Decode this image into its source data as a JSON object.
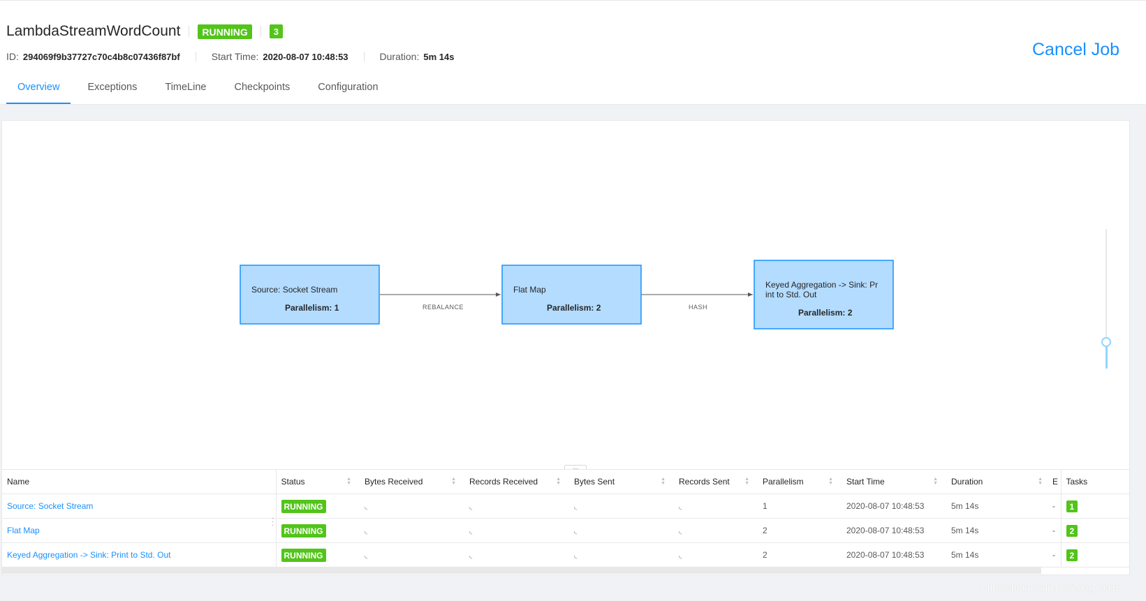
{
  "job": {
    "name": "LambdaStreamWordCount",
    "status": "RUNNING",
    "task_count": "3",
    "id_label": "ID:",
    "id_value": "294069f9b37727c70c4b8c07436f87bf",
    "start_time_label": "Start Time:",
    "start_time_value": "2020-08-07 10:48:53",
    "duration_label": "Duration:",
    "duration_value": "5m 14s",
    "cancel_label": "Cancel Job"
  },
  "tabs": [
    {
      "label": "Overview",
      "active": true
    },
    {
      "label": "Exceptions"
    },
    {
      "label": "TimeLine"
    },
    {
      "label": "Checkpoints"
    },
    {
      "label": "Configuration"
    }
  ],
  "graph": {
    "nodes": [
      {
        "line1": "Source: Socket Stream",
        "line2": "",
        "parallelism": "Parallelism: 1"
      },
      {
        "line1": "Flat Map",
        "line2": "",
        "parallelism": "Parallelism: 2"
      },
      {
        "line1": "Keyed Aggregation -> Sink: Pr",
        "line2": "int to Std. Out",
        "parallelism": "Parallelism: 2"
      }
    ],
    "edges": [
      {
        "label": "REBALANCE"
      },
      {
        "label": "HASH"
      }
    ],
    "colors": {
      "node_fill": "#b3dcff",
      "node_stroke": "#1890ff",
      "edge": "#595959"
    }
  },
  "table": {
    "columns": [
      "Name",
      "Status",
      "Bytes Received",
      "Records Received",
      "Bytes Sent",
      "Records Sent",
      "Parallelism",
      "Start Time",
      "Duration",
      "E",
      "Tasks"
    ],
    "rows": [
      {
        "name": "Source: Socket Stream",
        "status": "RUNNING",
        "bytes_received": "◟",
        "records_received": "◟",
        "bytes_sent": "◟",
        "records_sent": "◟",
        "parallelism": "1",
        "start_time": "2020-08-07 10:48:53",
        "duration": "5m 14s",
        "end": "-",
        "tasks": "1"
      },
      {
        "name": "Flat Map",
        "status": "RUNNING",
        "bytes_received": "◟",
        "records_received": "◟",
        "bytes_sent": "◟",
        "records_sent": "◟",
        "parallelism": "2",
        "start_time": "2020-08-07 10:48:53",
        "duration": "5m 14s",
        "end": "-",
        "tasks": "2"
      },
      {
        "name": "Keyed Aggregation -> Sink: Print to Std. Out",
        "status": "RUNNING",
        "bytes_received": "◟",
        "records_received": "◟",
        "bytes_sent": "◟",
        "records_sent": "◟",
        "parallelism": "2",
        "start_time": "2020-08-07 10:48:53",
        "duration": "5m 14s",
        "end": "-",
        "tasks": "2"
      }
    ]
  },
  "watermark": "https://blog.csdn.net/Zong_0915",
  "colors": {
    "accent": "#1890ff",
    "running": "#52c41a"
  }
}
